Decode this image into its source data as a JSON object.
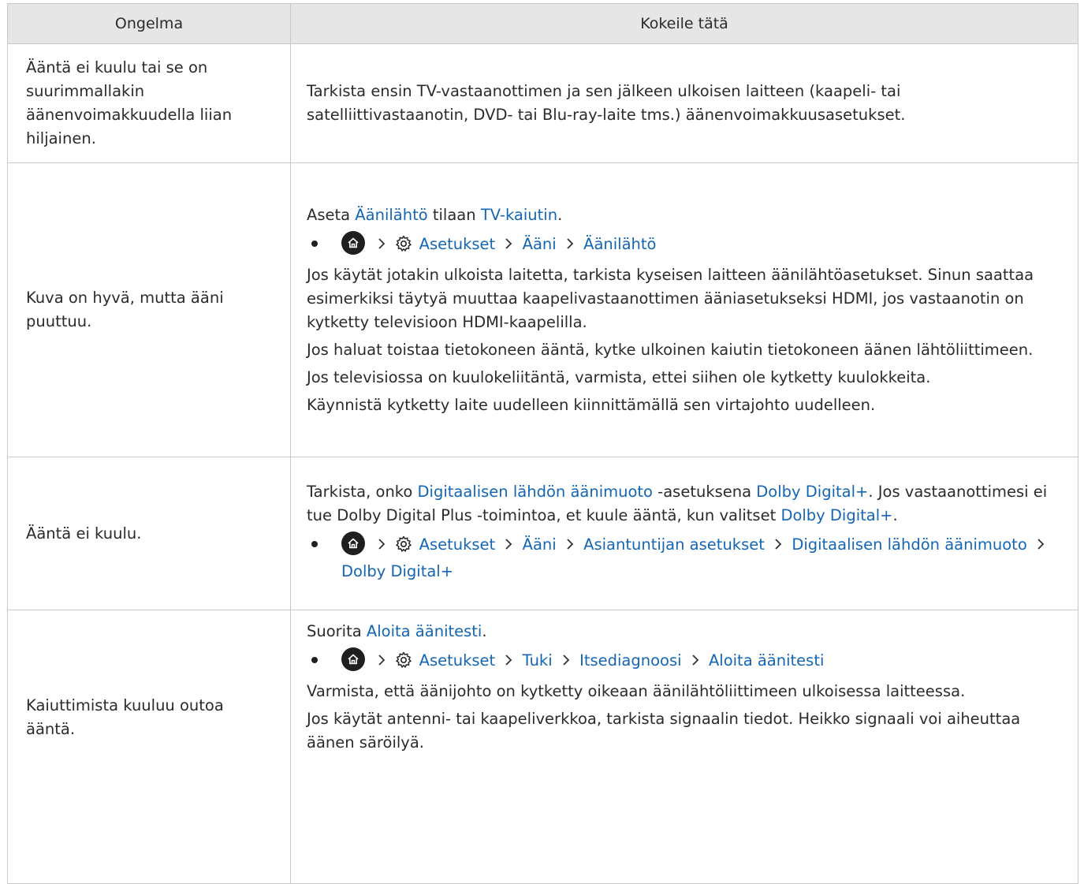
{
  "table": {
    "headers": {
      "problem": "Ongelma",
      "solution": "Kokeile tätä"
    },
    "rows": [
      {
        "problem": "Ääntä ei kuulu tai se on suurimmallakin äänenvoimakkuudella liian hiljainen.",
        "solution": "Tarkista ensin TV-vastaanottimen ja sen jälkeen ulkoisen laitteen (kaapeli- tai satelliittivastaanotin, DVD- tai Blu-ray-laite tms.) äänenvoimakkuusasetukset."
      },
      {
        "problem": "Kuva on hyvä, mutta ääni puuttuu.",
        "intro": {
          "pre": "Aseta ",
          "link1": "Äänilähtö",
          "mid": " tilaan ",
          "link2": "TV-kaiutin",
          "post": "."
        },
        "path": [
          "Asetukset",
          "Ääni",
          "Äänilähtö"
        ],
        "p1": "Jos käytät jotakin ulkoista laitetta, tarkista kyseisen laitteen äänilähtöasetukset. Sinun saattaa esimerkiksi täytyä muuttaa kaapelivastaanottimen ääniasetukseksi HDMI, jos vastaanotin on kytketty televisioon HDMI-kaapelilla.",
        "p2": "Jos haluat toistaa tietokoneen ääntä, kytke ulkoinen kaiutin tietokoneen äänen lähtöliittimeen.",
        "p3": "Jos televisiossa on kuulokeliitäntä, varmista, ettei siihen ole kytketty kuulokkeita.",
        "p4": "Käynnistä kytketty laite uudelleen kiinnittämällä sen virtajohto uudelleen."
      },
      {
        "problem": "Ääntä ei kuulu.",
        "intro": {
          "pre": "Tarkista, onko ",
          "link1": "Digitaalisen lähdön äänimuoto",
          "mid": " -asetuksena ",
          "link2": "Dolby Digital+",
          "post": ". Jos vastaanottimesi ei tue Dolby Digital Plus -toimintoa, et kuule ääntä, kun valitset ",
          "link3": "Dolby Digital+",
          "end": "."
        },
        "path": [
          "Asetukset",
          "Ääni",
          "Asiantuntijan asetukset",
          "Digitaalisen lähdön äänimuoto",
          "Dolby Digital+"
        ]
      },
      {
        "problem": "Kaiuttimista kuuluu outoa ääntä.",
        "intro": {
          "pre": "Suorita ",
          "link1": "Aloita äänitesti",
          "post": "."
        },
        "path": [
          "Asetukset",
          "Tuki",
          "Itsediagnoosi",
          "Aloita äänitesti"
        ],
        "p1": "Varmista, että äänijohto on kytketty oikeaan äänilähtöliittimeen ulkoisessa laitteessa.",
        "p2": "Jos käytät antenni- tai kaapeliverkkoa, tarkista signaalin tiedot. Heikko signaali voi aiheuttaa äänen säröilyä."
      }
    ]
  },
  "icons": {
    "home": "home-icon",
    "settings": "gear-icon",
    "separator": "chevron-right-icon"
  },
  "colors": {
    "link": "#1466b4",
    "header_bg": "#e6e6e6",
    "border": "#c9c9c9",
    "text": "#2b2b2b"
  }
}
